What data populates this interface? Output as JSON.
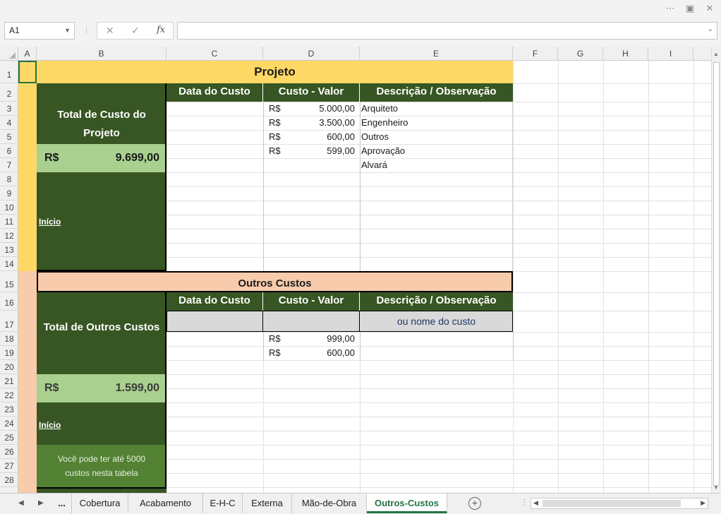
{
  "formula_bar": {
    "name_box": "A1",
    "cancel_glyph": "✕",
    "enter_glyph": "✓",
    "fx_label": "fx",
    "formula_value": ""
  },
  "columns": [
    "A",
    "B",
    "C",
    "D",
    "E",
    "F",
    "G",
    "H",
    "I"
  ],
  "rows": [
    "1",
    "2",
    "3",
    "4",
    "5",
    "6",
    "7",
    "8",
    "9",
    "10",
    "11",
    "12",
    "13",
    "14",
    "15",
    "16",
    "17",
    "18",
    "19",
    "20",
    "21",
    "22",
    "23",
    "24",
    "25",
    "26",
    "27",
    "28"
  ],
  "projeto": {
    "title": "Projeto",
    "total_label": "Total de Custo do Projeto",
    "currency": "R$",
    "total_value": "9.699,00",
    "link_inicio": "Início",
    "headers": [
      "Data do Custo",
      "Custo - Valor",
      "Descrição / Observação"
    ],
    "entries": [
      {
        "currency": "R$",
        "value": "5.000,00",
        "desc": "Arquiteto"
      },
      {
        "currency": "R$",
        "value": "3.500,00",
        "desc": "Engenheiro"
      },
      {
        "currency": "R$",
        "value": "600,00",
        "desc": "Outros"
      },
      {
        "currency": "R$",
        "value": "599,00",
        "desc": "Aprovação"
      },
      {
        "currency": "",
        "value": "",
        "desc": "Alvará"
      }
    ]
  },
  "outros": {
    "title": "Outros Custos",
    "total_label": "Total de Outros Custos",
    "currency": "R$",
    "total_value": "1.599,00",
    "link_inicio": "Início",
    "note": "Você pode ter até 5000 custos nesta tabela",
    "headers": [
      "Data do Custo",
      "Custo - Valor",
      "Descrição / Observação"
    ],
    "placeholder_desc": "ou nome do custo",
    "entries": [
      {
        "currency": "R$",
        "value": "999,00"
      },
      {
        "currency": "R$",
        "value": "600,00"
      }
    ]
  },
  "sheet_tabs": {
    "more": "...",
    "tabs": [
      "Cobertura",
      "Acabamento",
      "E-H-C",
      "Externa",
      "Mão-de-Obra",
      "Outros-Custos"
    ],
    "active": "Outros-Custos",
    "add_glyph": "+"
  },
  "colors": {
    "dark_green": "#375623",
    "light_green": "#a9d08e",
    "mid_green": "#548235",
    "yellow": "#ffd966",
    "peach": "#f8cbad",
    "gray_fill": "#d9d9d9",
    "placeholder_text": "#1f3864",
    "tab_active": "#217346"
  },
  "icons": {
    "window_more": "more-options-icon",
    "window_restore": "restore-icon",
    "name_box_dropdown": "chevron-down-icon",
    "cancel": "close-icon",
    "enter": "checkmark-icon",
    "function": "function-icon",
    "add_sheet": "plus-circle-icon"
  }
}
